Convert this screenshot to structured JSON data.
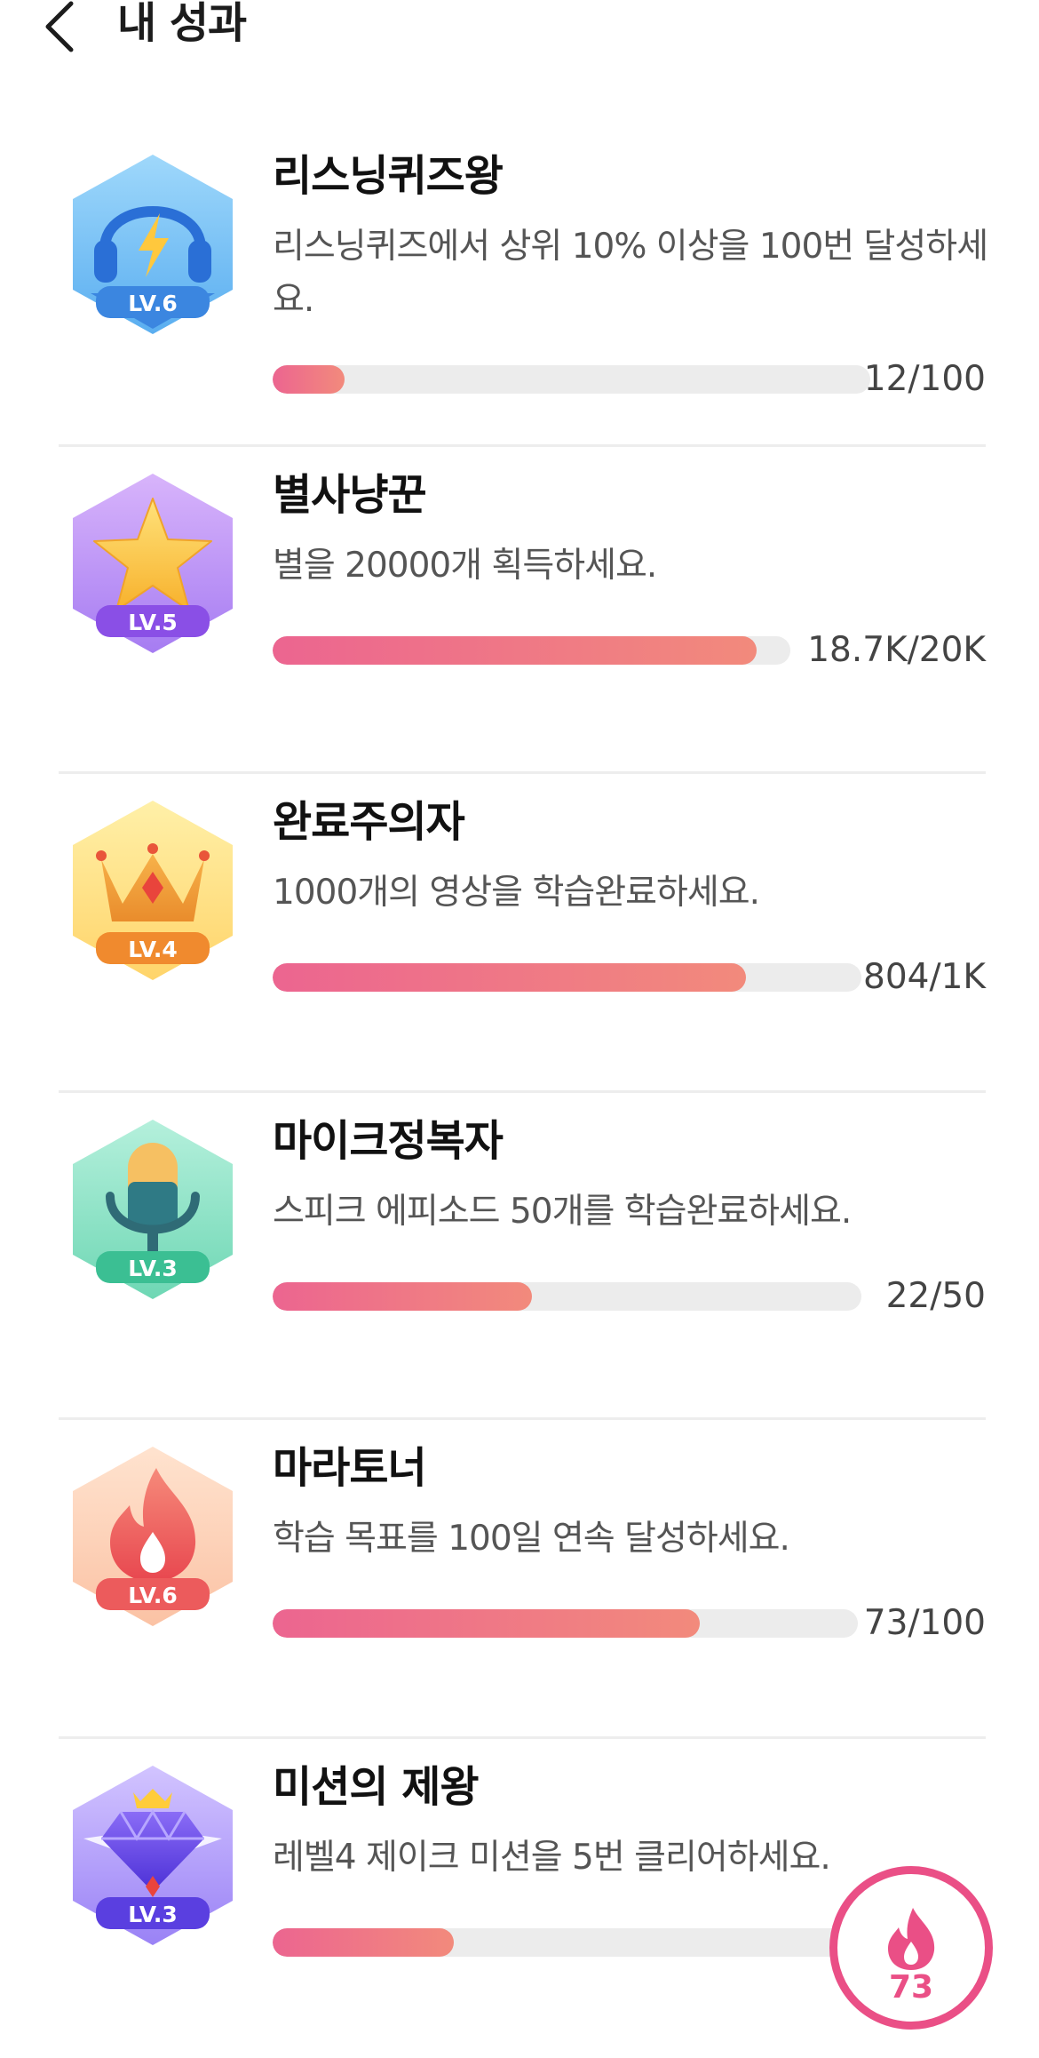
{
  "header": {
    "title": "내 성과"
  },
  "achievements": [
    {
      "title": "리스닝퀴즈왕",
      "desc": "리스닝퀴즈에서 상위 10% 이상을 100번 달성하세요.",
      "level": "LV.6",
      "icon": "headphones-icon",
      "progress": 0.12,
      "count": "12/100"
    },
    {
      "title": "별사냥꾼",
      "desc": "별을 20000개 획득하세요.",
      "level": "LV.5",
      "icon": "star-icon",
      "progress": 0.935,
      "count": "18.7K/20K"
    },
    {
      "title": "완료주의자",
      "desc": "1000개의 영상을 학습완료하세요.",
      "level": "LV.4",
      "icon": "crown-icon",
      "progress": 0.804,
      "count": "804/1K"
    },
    {
      "title": "마이크정복자",
      "desc": "스피크 에피소드 50개를 학습완료하세요.",
      "level": "LV.3",
      "icon": "microphone-icon",
      "progress": 0.44,
      "count": "22/50"
    },
    {
      "title": "마라토너",
      "desc": "학습 목표를 100일 연속 달성하세요.",
      "level": "LV.6",
      "icon": "flame-icon",
      "progress": 0.73,
      "count": "73/100"
    },
    {
      "title": "미션의 제왕",
      "desc": "레벨4 제이크 미션을 5번 클리어하세요.",
      "level": "LV.3",
      "icon": "diamond-icon",
      "progress": 0.3,
      "count": ""
    }
  ],
  "streak": {
    "icon": "flame-icon",
    "count": "73"
  }
}
